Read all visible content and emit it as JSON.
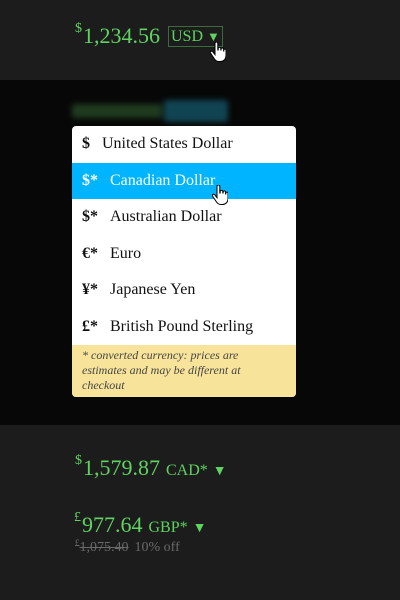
{
  "top_price": {
    "symbol": "$",
    "amount": "1,234.56",
    "currency": "USD",
    "arrow": "▼"
  },
  "dropdown": {
    "options": [
      {
        "symbol": "$",
        "label": "United States Dollar",
        "selected": false
      },
      {
        "symbol": "$*",
        "label": "Canadian Dollar",
        "selected": true
      },
      {
        "symbol": "$*",
        "label": "Australian Dollar",
        "selected": false
      },
      {
        "symbol": "€*",
        "label": "Euro",
        "selected": false
      },
      {
        "symbol": "¥*",
        "label": "Japanese Yen",
        "selected": false
      },
      {
        "symbol": "£*",
        "label": "British Pound Sterling",
        "selected": false
      }
    ],
    "note": "* converted currency: prices are estimates and may be different at checkout"
  },
  "cad_price": {
    "symbol": "$",
    "amount": "1,579.87",
    "currency": "CAD*",
    "arrow": "▼"
  },
  "gbp_price": {
    "symbol": "£",
    "amount": "977.64",
    "currency": "GBP*",
    "arrow": "▼",
    "old_symbol": "£",
    "old_amount": "1,075.40",
    "discount": "10% off"
  },
  "colors": {
    "price_green": "#5fd35f",
    "selected_blue": "#00b4ff",
    "note_yellow": "#f7e49a"
  },
  "icons": [
    "hand-pointer-icon",
    "chevron-down-icon"
  ]
}
